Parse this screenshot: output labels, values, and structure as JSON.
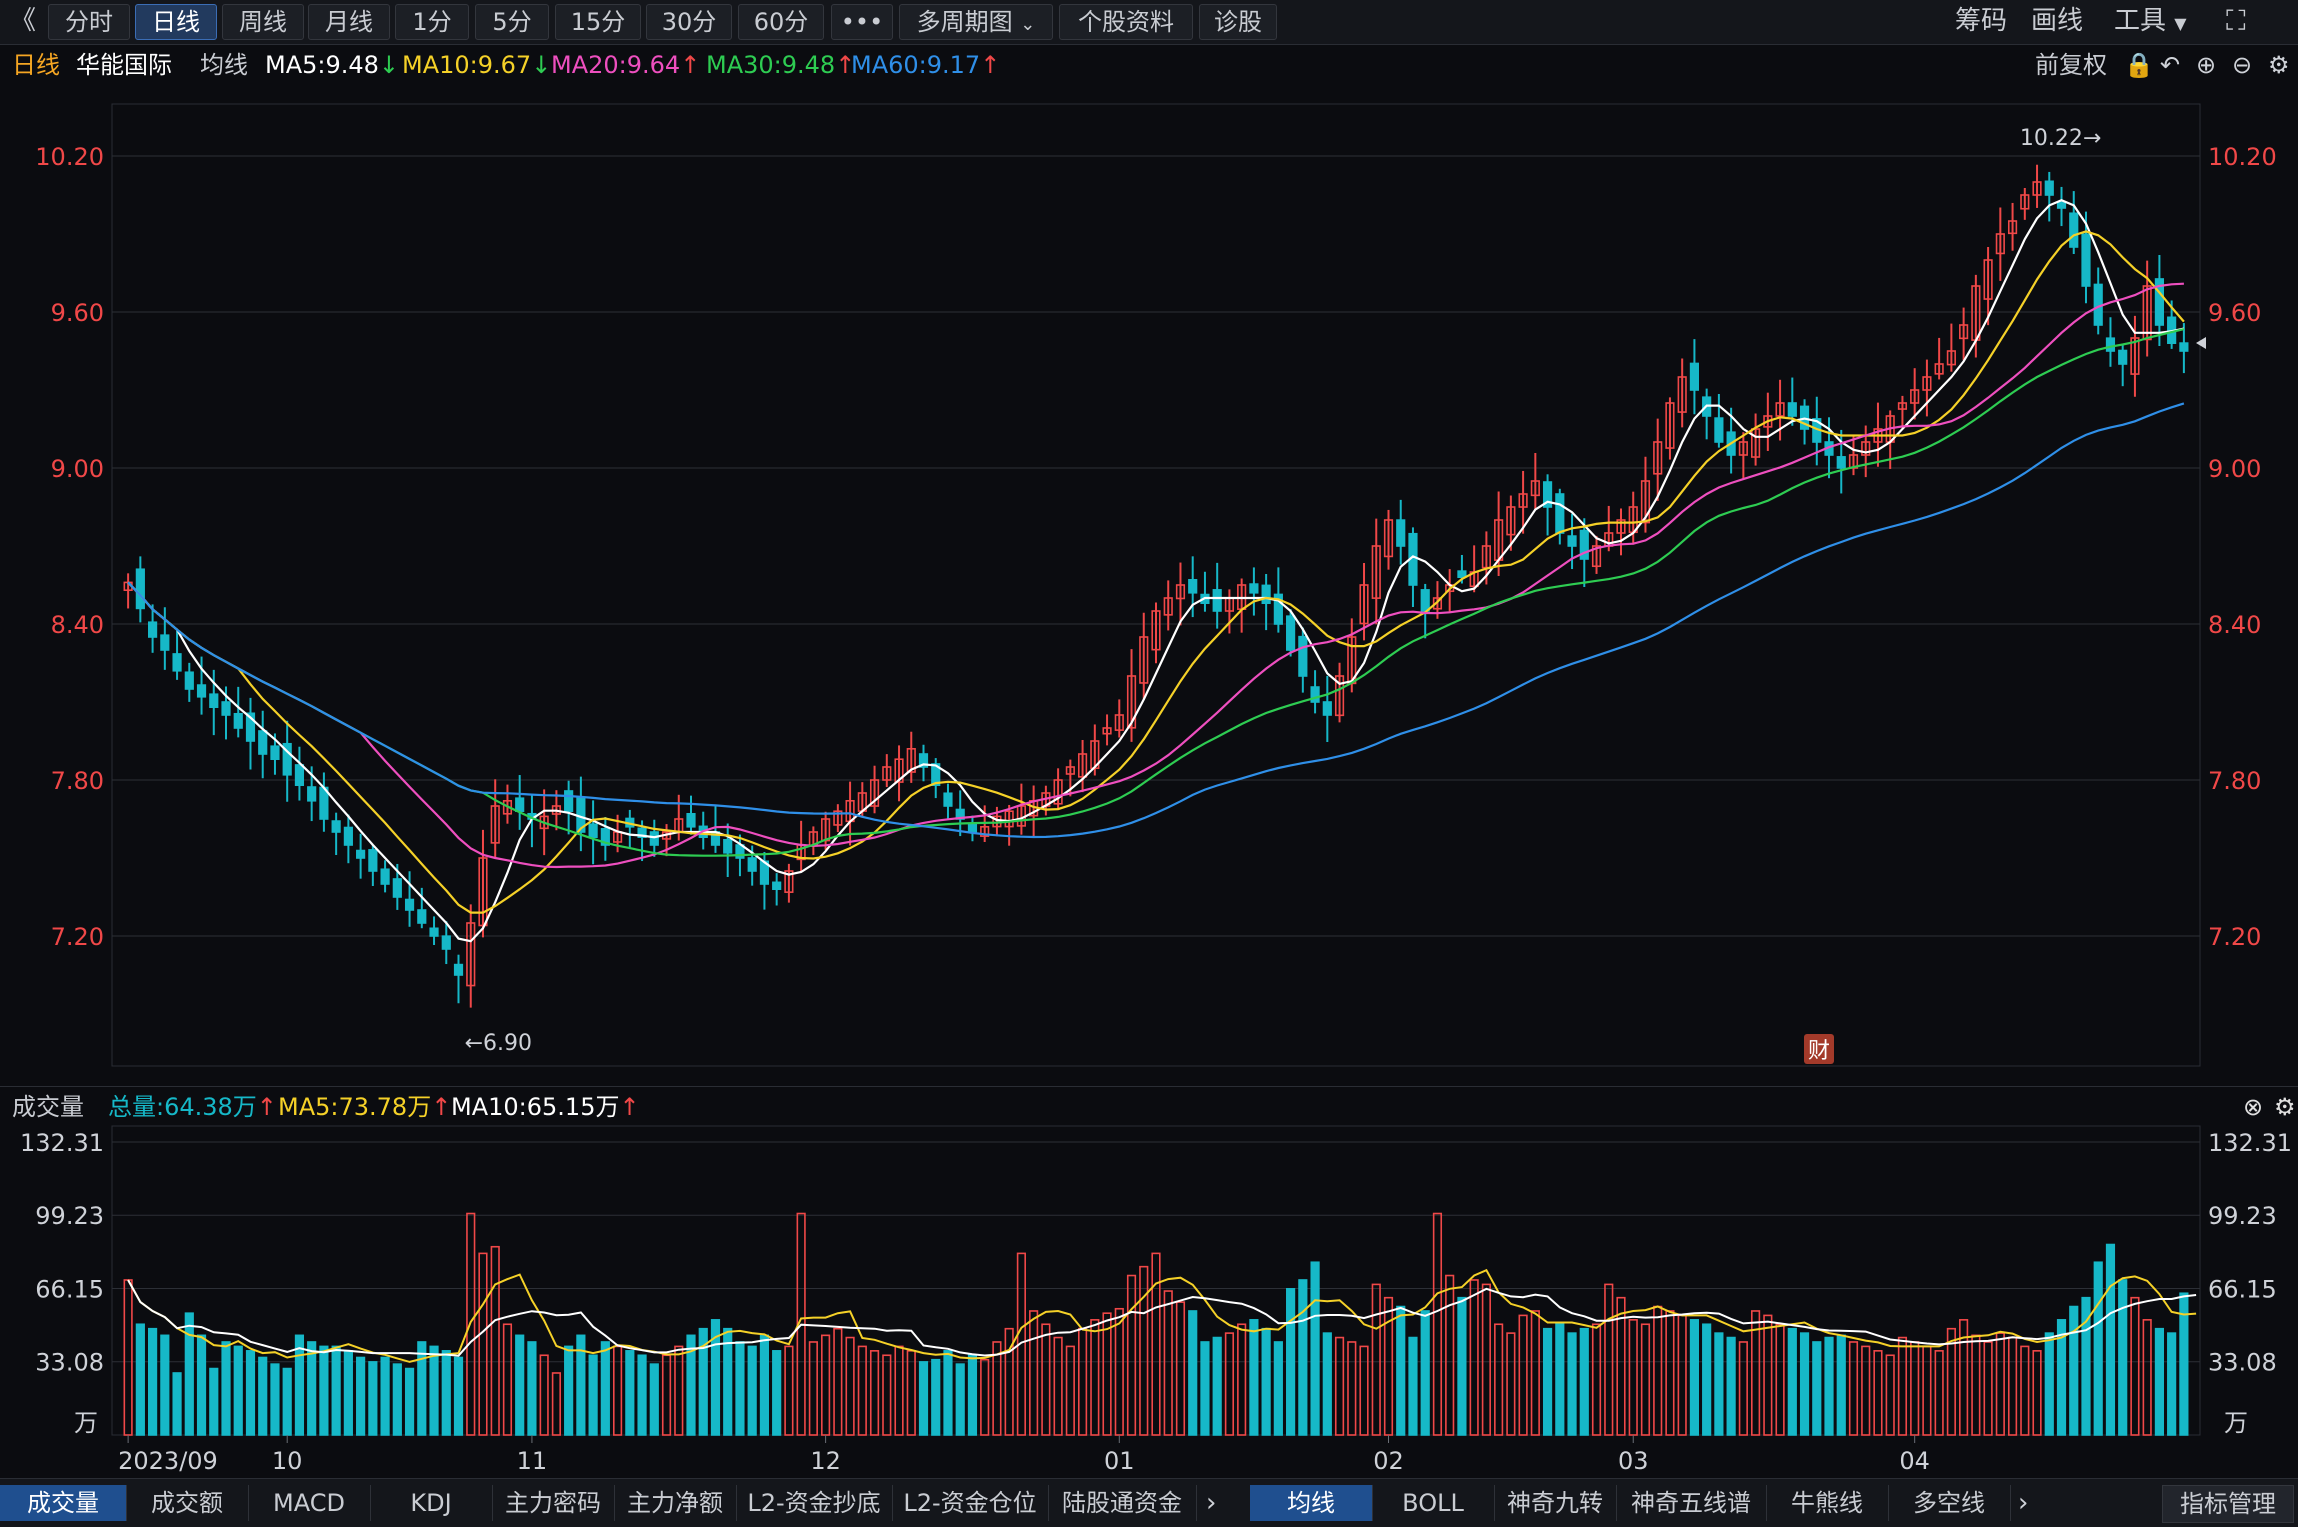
{
  "toolbar": {
    "back_glyph": "《",
    "tabs": [
      "分时",
      "日线",
      "周线",
      "月线",
      "1分",
      "5分",
      "15分",
      "30分",
      "60分"
    ],
    "active_tab": "日线",
    "more": "•••",
    "multi_period": "多周期图",
    "stock_info": "个股资料",
    "diagnose": "诊股",
    "right": [
      "筹码",
      "画线",
      "工具"
    ]
  },
  "info": {
    "period": "日线",
    "stock_name": "华能国际",
    "avg_label": "均线",
    "ma": [
      {
        "label": "MA5:9.48",
        "dir": "down",
        "color": "#ffffff"
      },
      {
        "label": "MA10:9.67",
        "dir": "down",
        "color": "#f5d128"
      },
      {
        "label": "MA20:9.64",
        "dir": "up",
        "color": "#ee4fbf"
      },
      {
        "label": "MA30:9.48",
        "dir": "up",
        "color": "#2ecc52"
      },
      {
        "label": "MA60:9.17",
        "dir": "up",
        "color": "#2f8fe8"
      }
    ],
    "adjust": "前复权"
  },
  "volume_info": {
    "title": "成交量",
    "total": "总量:64.38万",
    "ma5": "MA5:73.78万",
    "ma10": "MA10:65.15万"
  },
  "bottom_tabs_left": [
    "成交量",
    "成交额",
    "MACD",
    "KDJ",
    "主力密码",
    "主力净额",
    "L2-资金抄底",
    "L2-资金仓位",
    "陆股通资金"
  ],
  "bottom_tabs_right": [
    "均线",
    "BOLL",
    "神奇九转",
    "神奇五线谱",
    "牛熊线",
    "多空线"
  ],
  "indicator_manage": "指标管理",
  "colors": {
    "up": "#f04848",
    "down": "#16b8c8",
    "ma5": "#ffffff",
    "ma10": "#f5d128",
    "ma20": "#ee4fbf",
    "ma30": "#2ecc52",
    "ma60": "#2f8fe8"
  },
  "chart_data": {
    "type": "candlestick",
    "price_axis": {
      "ticks": [
        "10.20",
        "9.60",
        "9.00",
        "8.40",
        "7.80",
        "7.20"
      ],
      "range": [
        6.7,
        10.4
      ]
    },
    "volume_axis": {
      "ticks": [
        "132.31",
        "99.23",
        "66.15",
        "33.08"
      ],
      "unit": "万",
      "range": [
        0,
        135
      ]
    },
    "x_labels": [
      {
        "text": "2023/09",
        "i": 0
      },
      {
        "text": "10",
        "i": 13
      },
      {
        "text": "11",
        "i": 33
      },
      {
        "text": "12",
        "i": 57
      },
      {
        "text": "01",
        "i": 81
      },
      {
        "text": "02",
        "i": 103
      },
      {
        "text": "03",
        "i": 123
      },
      {
        "text": "04",
        "i": 146
      }
    ],
    "annotations": {
      "high": {
        "text": "10.22→",
        "i": 160
      },
      "low": {
        "text": "←6.90",
        "i": 28
      },
      "badge": "财"
    },
    "close": [
      8.56,
      8.46,
      8.35,
      8.3,
      8.22,
      8.15,
      8.12,
      8.08,
      8.05,
      8.0,
      7.95,
      7.9,
      7.88,
      7.82,
      7.78,
      7.72,
      7.65,
      7.6,
      7.55,
      7.5,
      7.45,
      7.4,
      7.35,
      7.3,
      7.25,
      7.2,
      7.15,
      7.05,
      7.25,
      7.5,
      7.7,
      7.72,
      7.68,
      7.65,
      7.66,
      7.7,
      7.68,
      7.6,
      7.58,
      7.55,
      7.6,
      7.62,
      7.58,
      7.55,
      7.6,
      7.65,
      7.62,
      7.58,
      7.55,
      7.52,
      7.5,
      7.45,
      7.4,
      7.38,
      7.45,
      7.55,
      7.6,
      7.65,
      7.68,
      7.72,
      7.75,
      7.8,
      7.85,
      7.88,
      7.92,
      7.85,
      7.78,
      7.7,
      7.65,
      7.6,
      7.62,
      7.66,
      7.68,
      7.7,
      7.72,
      7.75,
      7.8,
      7.85,
      7.9,
      7.95,
      8.0,
      8.05,
      8.2,
      8.35,
      8.45,
      8.5,
      8.55,
      8.52,
      8.48,
      8.45,
      8.5,
      8.55,
      8.52,
      8.48,
      8.4,
      8.3,
      8.2,
      8.1,
      8.05,
      8.2,
      8.35,
      8.55,
      8.7,
      8.8,
      8.7,
      8.55,
      8.45,
      8.5,
      8.55,
      8.58,
      8.6,
      8.7,
      8.8,
      8.85,
      8.9,
      8.95,
      8.85,
      8.75,
      8.7,
      8.65,
      8.7,
      8.75,
      8.8,
      8.85,
      8.95,
      9.1,
      9.25,
      9.35,
      9.3,
      9.2,
      9.1,
      9.05,
      9.1,
      9.15,
      9.2,
      9.25,
      9.2,
      9.15,
      9.1,
      9.05,
      9.0,
      9.05,
      9.1,
      9.15,
      9.2,
      9.25,
      9.3,
      9.35,
      9.4,
      9.45,
      9.55,
      9.7,
      9.8,
      9.9,
      9.95,
      10.05,
      10.1,
      10.05,
      10.0,
      9.85,
      9.7,
      9.55,
      9.45,
      9.4,
      9.5,
      9.7,
      9.55,
      9.48,
      9.45
    ],
    "volume": [
      70,
      50,
      48,
      45,
      28,
      55,
      45,
      30,
      42,
      40,
      38,
      35,
      32,
      30,
      45,
      42,
      40,
      40,
      38,
      35,
      33,
      35,
      32,
      30,
      42,
      40,
      38,
      35,
      100,
      82,
      85,
      50,
      45,
      42,
      36,
      28,
      40,
      45,
      36,
      42,
      40,
      38,
      36,
      32,
      36,
      40,
      45,
      48,
      52,
      48,
      42,
      40,
      45,
      38,
      40,
      100,
      42,
      45,
      48,
      44,
      40,
      38,
      36,
      40,
      38,
      33,
      34,
      38,
      32,
      36,
      34,
      42,
      48,
      82,
      56,
      50,
      44,
      40,
      48,
      52,
      55,
      57,
      72,
      76,
      82,
      65,
      60,
      56,
      42,
      44,
      46,
      50,
      52,
      48,
      42,
      66,
      70,
      78,
      46,
      44,
      42,
      40,
      68,
      62,
      58,
      44,
      56,
      100,
      72,
      62,
      70,
      68,
      50,
      46,
      54,
      56,
      48,
      50,
      46,
      48,
      50,
      68,
      62,
      52,
      50,
      58,
      56,
      54,
      52,
      50,
      46,
      44,
      42,
      56,
      54,
      50,
      48,
      46,
      42,
      44,
      45,
      42,
      40,
      38,
      36,
      44,
      42,
      40,
      38,
      48,
      52,
      45,
      42,
      46,
      44,
      40,
      38,
      46,
      52,
      58,
      62,
      78,
      86,
      70,
      62,
      52,
      48,
      46,
      64,
      64
    ]
  }
}
